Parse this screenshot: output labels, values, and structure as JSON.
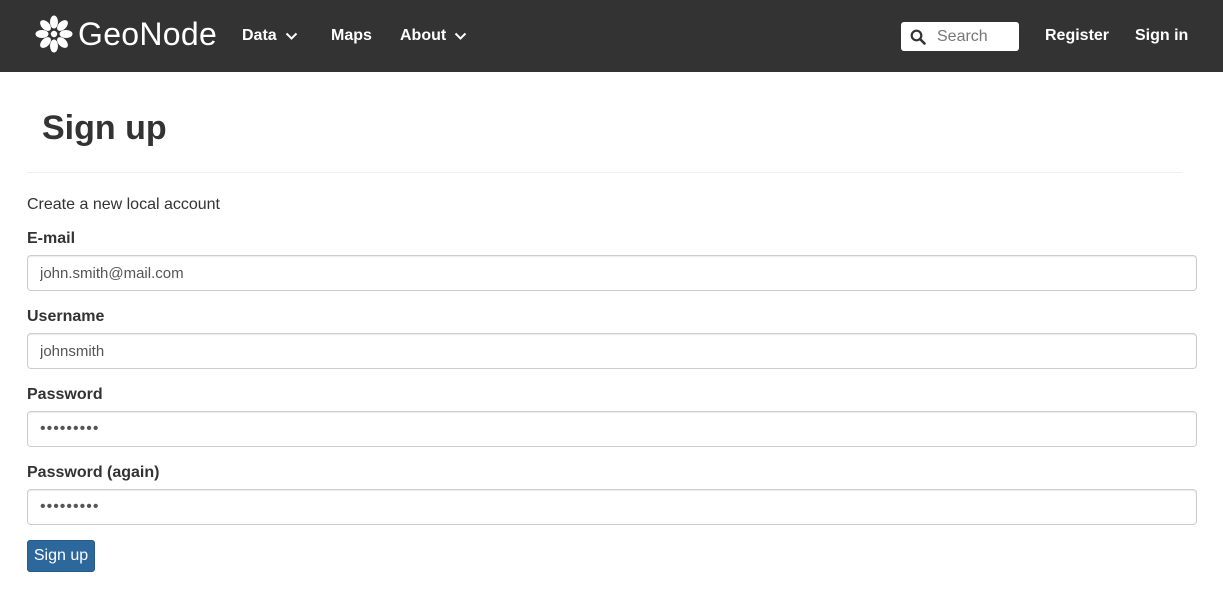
{
  "navbar": {
    "brand": {
      "name": "GeoNode",
      "icon": "geonode-logo-icon"
    },
    "menu": [
      {
        "label": "Data",
        "has_dropdown": true
      },
      {
        "label": "Maps",
        "has_dropdown": false
      },
      {
        "label": "About",
        "has_dropdown": true
      }
    ],
    "search": {
      "placeholder": "Search",
      "value": "",
      "icon": "search-icon"
    },
    "register_label": "Register",
    "signin_label": "Sign in",
    "background_color": "#333333"
  },
  "page": {
    "title": "Sign up",
    "intro": "Create a new local account"
  },
  "form": {
    "email": {
      "label": "E-mail",
      "value": "john.smith@mail.com"
    },
    "username": {
      "label": "Username",
      "value": "johnsmith"
    },
    "password": {
      "label": "Password",
      "value": "123456789"
    },
    "password_again": {
      "label": "Password (again)",
      "value": "123456789"
    },
    "submit_label": "Sign up",
    "submit_color": "#2c689c"
  }
}
